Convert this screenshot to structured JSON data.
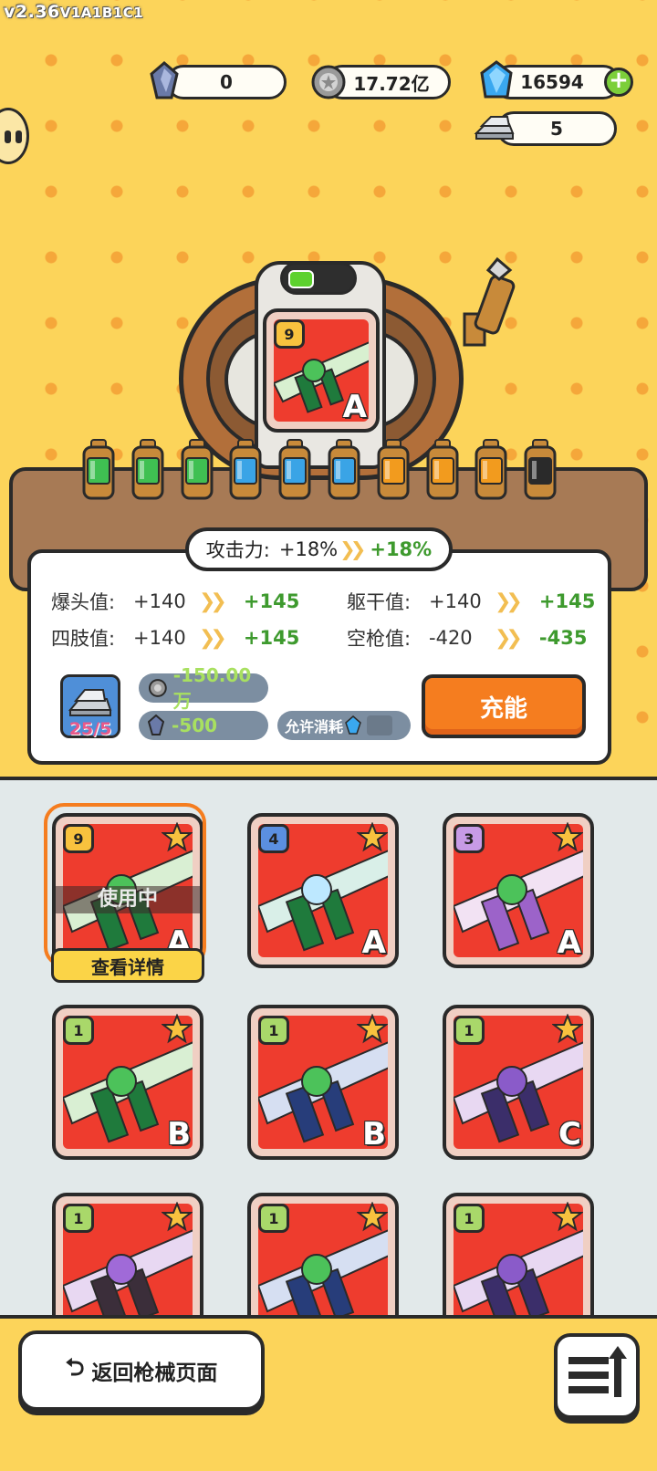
{
  "version": {
    "main": "v2.36",
    "suffix": "V1A1B1C1"
  },
  "currencies": {
    "crystal_dark": "0",
    "coin": "17.72亿",
    "diamond": "16594",
    "silver_bars": "5"
  },
  "machine": {
    "card": {
      "level": "9",
      "grade": "A"
    },
    "bottles": [
      "green",
      "green",
      "green",
      "blue",
      "blue",
      "blue",
      "orange",
      "orange",
      "orange",
      "black"
    ],
    "battery_fill": 0.33
  },
  "stats": {
    "attack_label": "攻击力:",
    "attack_current": "+18%",
    "attack_next": "+18%",
    "rows": [
      {
        "label": "爆头值:",
        "current": "+140",
        "next": "+145"
      },
      {
        "label": "躯干值:",
        "current": "+140",
        "next": "+145"
      },
      {
        "label": "四肢值:",
        "current": "+140",
        "next": "+145"
      },
      {
        "label": "空枪值:",
        "current": "-420",
        "next": "-435"
      }
    ],
    "material_count": "25/5",
    "cost_coin": "-150.00万",
    "cost_crystal": "-500",
    "allow_consume_label": "允许消耗",
    "charge_button": "充能"
  },
  "inventory": {
    "using_label": "使用中",
    "detail_button": "查看详情",
    "items": [
      {
        "level": "9",
        "grade": "A",
        "badge_color": "#f8c23e",
        "theme": "green"
      },
      {
        "level": "4",
        "grade": "A",
        "badge_color": "#5b8fe0",
        "theme": "ice"
      },
      {
        "level": "3",
        "grade": "A",
        "badge_color": "#c79be6",
        "theme": "purple"
      },
      {
        "level": "1",
        "grade": "B",
        "badge_color": "#a9d86a",
        "theme": "green"
      },
      {
        "level": "1",
        "grade": "B",
        "badge_color": "#a9d86a",
        "theme": "navy"
      },
      {
        "level": "1",
        "grade": "C",
        "badge_color": "#a9d86a",
        "theme": "violet"
      },
      {
        "level": "1",
        "grade": "",
        "badge_color": "#a9d86a",
        "theme": "dark"
      },
      {
        "level": "1",
        "grade": "",
        "badge_color": "#a9d86a",
        "theme": "navy"
      },
      {
        "level": "1",
        "grade": "",
        "badge_color": "#a9d86a",
        "theme": "violet"
      }
    ]
  },
  "footer": {
    "back_label": "返回枪械页面"
  },
  "colors": {
    "accent": "#f57d1f",
    "positive": "#3e9a2e",
    "background": "#fcd45a"
  }
}
